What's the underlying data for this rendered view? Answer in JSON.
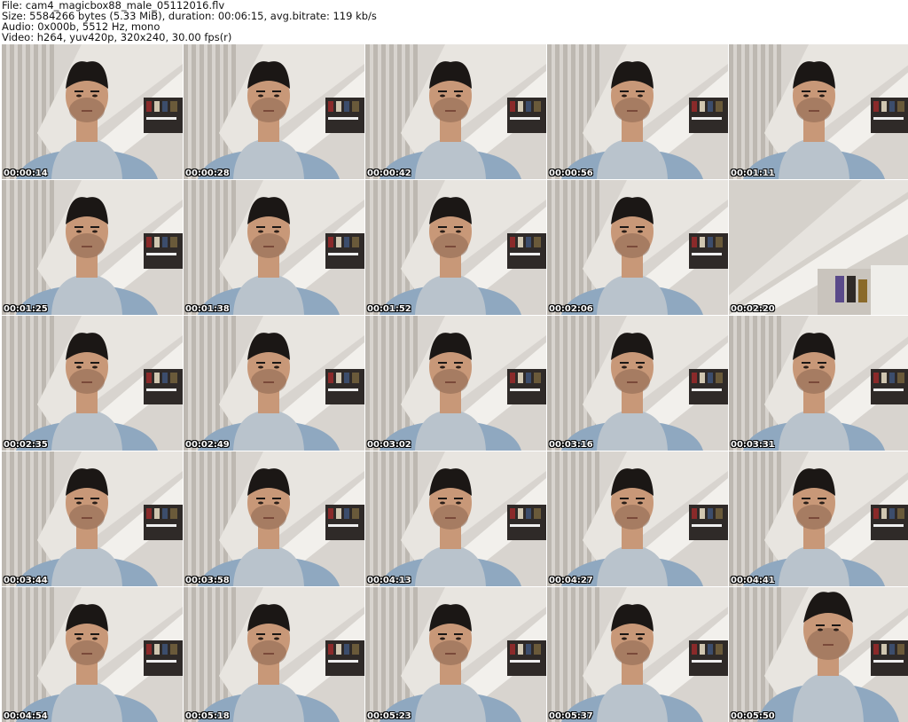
{
  "header": {
    "file": "File: cam4_magicbox88_male_05112016.flv",
    "size": "Size: 5584266 bytes (5.33 MiB), duration: 00:06:15, avg.bitrate: 119 kb/s",
    "audio": "Audio: 0x000b, 5512 Hz, mono",
    "video": "Video: h264, yuv420p, 320x240, 30.00 fps(r)"
  },
  "thumbnails": [
    {
      "timestamp": "00:00:14",
      "scene": "person"
    },
    {
      "timestamp": "00:00:28",
      "scene": "person"
    },
    {
      "timestamp": "00:00:42",
      "scene": "person"
    },
    {
      "timestamp": "00:00:56",
      "scene": "person"
    },
    {
      "timestamp": "00:01:11",
      "scene": "person"
    },
    {
      "timestamp": "00:01:25",
      "scene": "person"
    },
    {
      "timestamp": "00:01:38",
      "scene": "person"
    },
    {
      "timestamp": "00:01:52",
      "scene": "person"
    },
    {
      "timestamp": "00:02:06",
      "scene": "person"
    },
    {
      "timestamp": "00:02:20",
      "scene": "empty-room"
    },
    {
      "timestamp": "00:02:35",
      "scene": "person"
    },
    {
      "timestamp": "00:02:49",
      "scene": "person"
    },
    {
      "timestamp": "00:03:02",
      "scene": "person"
    },
    {
      "timestamp": "00:03:16",
      "scene": "person"
    },
    {
      "timestamp": "00:03:31",
      "scene": "person"
    },
    {
      "timestamp": "00:03:44",
      "scene": "person"
    },
    {
      "timestamp": "00:03:58",
      "scene": "person"
    },
    {
      "timestamp": "00:04:13",
      "scene": "person"
    },
    {
      "timestamp": "00:04:27",
      "scene": "person"
    },
    {
      "timestamp": "00:04:41",
      "scene": "person"
    },
    {
      "timestamp": "00:04:54",
      "scene": "person"
    },
    {
      "timestamp": "00:05:18",
      "scene": "person"
    },
    {
      "timestamp": "00:05:23",
      "scene": "person"
    },
    {
      "timestamp": "00:05:37",
      "scene": "person"
    },
    {
      "timestamp": "00:05:50",
      "scene": "person-close"
    }
  ],
  "colors": {
    "wall": "#d8d4cf",
    "stair": "#f2f0ec",
    "blinds": "#bdb8b1",
    "skin": "#c89878",
    "hair": "#1b1715",
    "hoodie": "#b9c3cc",
    "jacket": "#8fa8c0",
    "shelf": "#2f2a28"
  }
}
